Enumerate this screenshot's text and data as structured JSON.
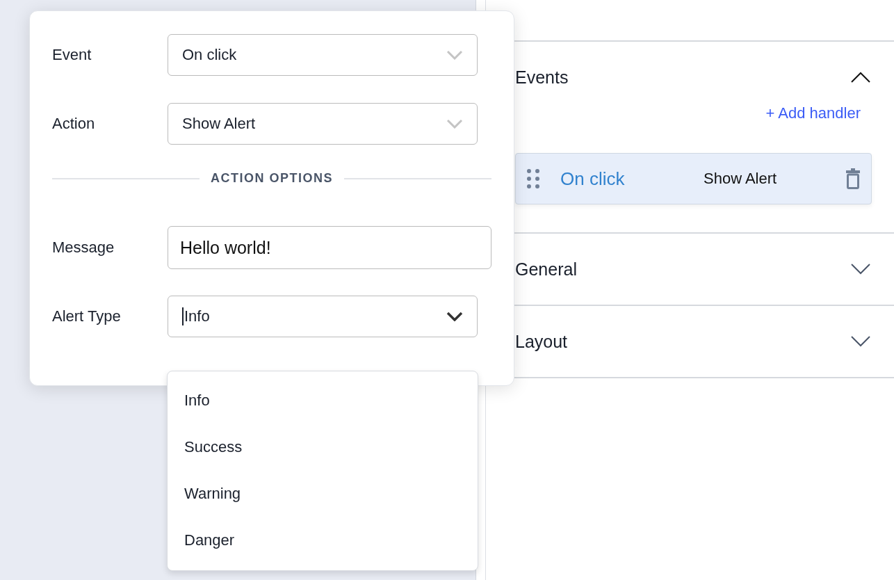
{
  "popover": {
    "fields": [
      {
        "kind": "select",
        "label": "Event",
        "value": "On click",
        "open": false
      },
      {
        "kind": "select",
        "label": "Action",
        "value": "Show Alert",
        "open": false
      }
    ],
    "section_title": "ACTION OPTIONS",
    "option_fields": [
      {
        "kind": "text",
        "label": "Message",
        "value": "Hello world!"
      },
      {
        "kind": "select",
        "label": "Alert Type",
        "value": "Info",
        "open": true
      }
    ]
  },
  "dropdown": {
    "options": [
      {
        "label": "Info",
        "selected": false
      },
      {
        "label": "Success",
        "selected": false
      },
      {
        "label": "Warning",
        "selected": false
      },
      {
        "label": "Danger",
        "selected": false
      }
    ]
  },
  "panel": {
    "sections": [
      {
        "title": "Events",
        "expanded": true,
        "add_link": "+ Add handler",
        "handlers": [
          {
            "event": "On click",
            "action": "Show Alert"
          }
        ]
      },
      {
        "title": "General",
        "expanded": false
      },
      {
        "title": "Layout",
        "expanded": false
      }
    ]
  }
}
